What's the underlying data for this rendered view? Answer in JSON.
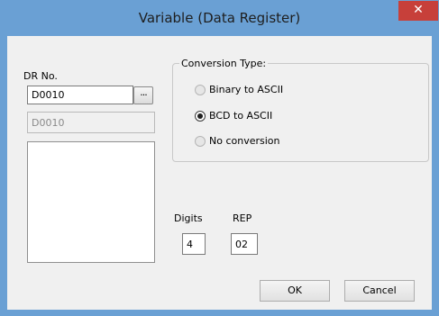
{
  "window": {
    "title": "Variable (Data Register)",
    "close_glyph": "✕",
    "title_bar_color": "#6aa0d4",
    "close_button_color": "#c7403a"
  },
  "dr": {
    "label": "DR No.",
    "value": "D0010",
    "browse_label": "...",
    "readonly_value": "D0010"
  },
  "conversion": {
    "title": "Conversion Type:",
    "options": [
      {
        "label": "Binary to ASCII",
        "selected": false,
        "enabled": false
      },
      {
        "label": "BCD to ASCII",
        "selected": true,
        "enabled": true
      },
      {
        "label": "No conversion",
        "selected": false,
        "enabled": false
      }
    ]
  },
  "digits": {
    "label": "Digits",
    "value": "4"
  },
  "rep": {
    "label": "REP",
    "value": "02"
  },
  "buttons": {
    "ok": "OK",
    "cancel": "Cancel"
  }
}
